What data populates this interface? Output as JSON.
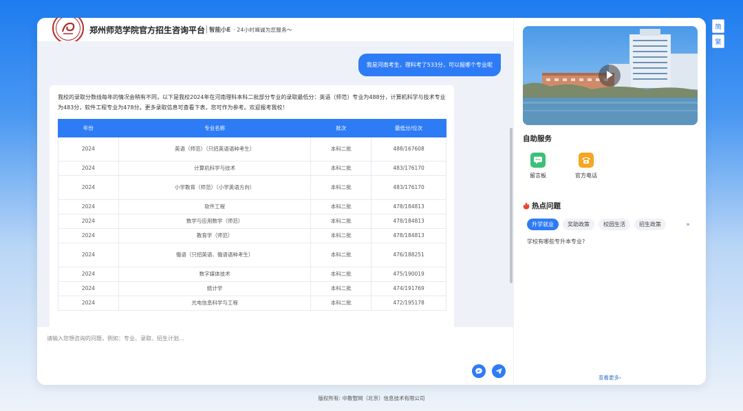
{
  "header": {
    "logo_text": "郑州师范学院",
    "title": "郑州师范学院官方招生咨询平台",
    "brand": "智能小E",
    "slogan": "· 24小时竭诚为您服务～"
  },
  "chat": {
    "user_message": "我是河南考生，理科考了533分，可以报哪个专业呢",
    "bot_message": "我校的录取分数线每年的情况会稍有不同，以下是我校2024年在河南理科本科二批部分专业的录取最低分：英语（师范）专业为488分，计算机科学与技术专业为483分，软件工程专业为478分。更多录取信息可查看下表，您可作为参考。欢迎报考我校！",
    "table": {
      "headers": [
        "年份",
        "专业名称",
        "批次",
        "最低分/位次"
      ],
      "rows": [
        {
          "year": "2024",
          "major": "英语（师范）（只招英语语种考生）",
          "batch": "本科二批",
          "score": "488/167608"
        },
        {
          "year": "2024",
          "major": "计算机科学与技术",
          "batch": "本科二批",
          "score": "483/176170"
        },
        {
          "year": "2024",
          "major": "小学教育（师范）（小学英语方向）",
          "batch": "本科二批",
          "score": "483/176170"
        },
        {
          "year": "2024",
          "major": "软件工程",
          "batch": "本科二批",
          "score": "478/184813"
        },
        {
          "year": "2024",
          "major": "数学与应用数学（师范）",
          "batch": "本科二批",
          "score": "478/184813"
        },
        {
          "year": "2024",
          "major": "教育学（师范）",
          "batch": "本科二批",
          "score": "478/184813"
        },
        {
          "year": "2024",
          "major": "俄语（只招英语、俄语语种考生）",
          "batch": "本科二批",
          "score": "476/188251"
        },
        {
          "year": "2024",
          "major": "数字媒体技术",
          "batch": "本科二批",
          "score": "475/190019"
        },
        {
          "year": "2024",
          "major": "统计学",
          "batch": "本科二批",
          "score": "474/191769"
        },
        {
          "year": "2024",
          "major": "光电信息科学与工程",
          "batch": "本科二批",
          "score": "472/195178"
        }
      ]
    }
  },
  "input": {
    "placeholder": "请输入您想咨询的问题，例如：专业、录取、招生计划..."
  },
  "sidebar": {
    "services_title": "自助服务",
    "services": [
      {
        "label": "留言板",
        "icon": "message-board-icon"
      },
      {
        "label": "官方电话",
        "icon": "phone-icon"
      }
    ],
    "hot_title": "热点问题",
    "tags": [
      "升学就业",
      "奖助政策",
      "校园生活",
      "招生政策"
    ],
    "active_tag": "升学就业",
    "faq": [
      "学校有哪些专升本专业?"
    ],
    "see_more": "查看更多"
  },
  "lang": {
    "simplified": "簡",
    "traditional": "繁"
  },
  "footer": "版权所有: 中教智网（北京）信息技术有限公司",
  "colors": {
    "primary": "#2e7bf6",
    "logo_red": "#b22a2a"
  }
}
